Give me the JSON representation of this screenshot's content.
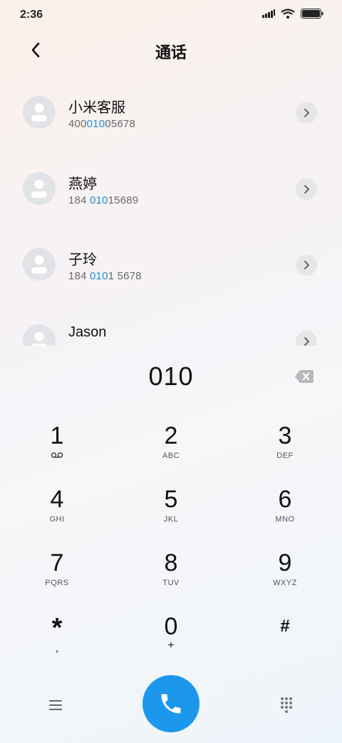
{
  "status_bar": {
    "time": "2:36",
    "icons": [
      "signal-icon",
      "wifi-icon",
      "battery-icon"
    ]
  },
  "header": {
    "title": "通话",
    "back_icon": "back-arrow-icon"
  },
  "contacts": [
    {
      "name": "小米客服",
      "number_parts": [
        "400",
        "010",
        "05678"
      ]
    },
    {
      "name": "燕婷",
      "number_parts": [
        "184 ",
        "010",
        "15689"
      ]
    },
    {
      "name": "子玲",
      "number_parts": [
        "184 ",
        "010",
        "1 5678"
      ]
    },
    {
      "name": "Jason",
      "number_parts": [
        "",
        "",
        ""
      ]
    }
  ],
  "dialed_number": "010",
  "keypad": [
    {
      "digit": "1",
      "letters": "",
      "icon": "voicemail-icon"
    },
    {
      "digit": "2",
      "letters": "ABC"
    },
    {
      "digit": "3",
      "letters": "DEF"
    },
    {
      "digit": "4",
      "letters": "GHI"
    },
    {
      "digit": "5",
      "letters": "JKL"
    },
    {
      "digit": "6",
      "letters": "MNO"
    },
    {
      "digit": "7",
      "letters": "PQRS"
    },
    {
      "digit": "8",
      "letters": "TUV"
    },
    {
      "digit": "9",
      "letters": "WXYZ"
    },
    {
      "digit": "*",
      "letters": ","
    },
    {
      "digit": "0",
      "letters": "+"
    },
    {
      "digit": "#",
      "letters": ""
    }
  ],
  "bottom_bar": {
    "menu_icon": "menu-icon",
    "call_icon": "phone-icon",
    "dialpad_icon": "dialpad-icon"
  },
  "colors": {
    "accent": "#1b97ee",
    "highlight": "#1d8fe0"
  }
}
